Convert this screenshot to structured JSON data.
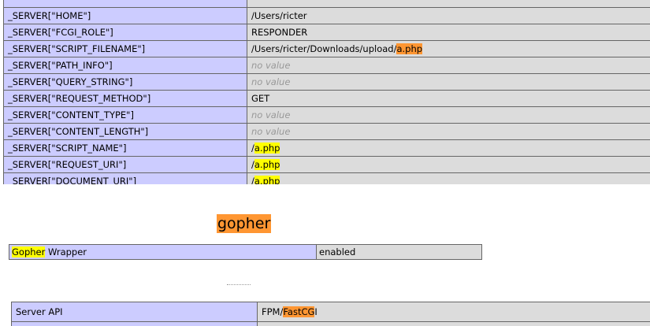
{
  "server_vars": [
    {
      "key": "_SERVER[\"HOME\"]",
      "value_parts": [
        {
          "text": "/Users/ricter",
          "hl": ""
        }
      ]
    },
    {
      "key": "_SERVER[\"FCGI_ROLE\"]",
      "value_parts": [
        {
          "text": "RESPONDER",
          "hl": ""
        }
      ]
    },
    {
      "key": "_SERVER[\"SCRIPT_FILENAME\"]",
      "value_parts": [
        {
          "text": "/Users/ricter/Downloads/upload/",
          "hl": ""
        },
        {
          "text": "a.php",
          "hl": "orange"
        }
      ]
    },
    {
      "key": "_SERVER[\"PATH_INFO\"]",
      "no_value": "no value"
    },
    {
      "key": "_SERVER[\"QUERY_STRING\"]",
      "no_value": "no value"
    },
    {
      "key": "_SERVER[\"REQUEST_METHOD\"]",
      "value_parts": [
        {
          "text": "GET",
          "hl": ""
        }
      ]
    },
    {
      "key": "_SERVER[\"CONTENT_TYPE\"]",
      "no_value": "no value"
    },
    {
      "key": "_SERVER[\"CONTENT_LENGTH\"]",
      "no_value": "no value"
    },
    {
      "key": "_SERVER[\"SCRIPT_NAME\"]",
      "value_parts": [
        {
          "text": "/",
          "hl": ""
        },
        {
          "text": "a.php",
          "hl": "yellow"
        }
      ]
    },
    {
      "key": "_SERVER[\"REQUEST_URI\"]",
      "value_parts": [
        {
          "text": "/",
          "hl": ""
        },
        {
          "text": "a.php",
          "hl": "yellow"
        }
      ]
    },
    {
      "key": "_SERVER[\"DOCUMENT_URI\"]",
      "value_parts": [
        {
          "text": "/",
          "hl": ""
        },
        {
          "text": "a.php",
          "hl": "yellow"
        }
      ]
    }
  ],
  "gopher": {
    "title": "gopher",
    "row_key_highlight": "Gopher",
    "row_key_rest": " Wrapper",
    "row_value": "enabled"
  },
  "server_api": {
    "key": "Server API",
    "value_prefix": "FPM/",
    "value_highlight": "FastCG",
    "value_suffix": "I"
  },
  "colors": {
    "key_cell": "#ccccff",
    "value_cell": "#dcdcdc",
    "highlight_yellow": "#ffff00",
    "highlight_orange": "#ff9632"
  }
}
